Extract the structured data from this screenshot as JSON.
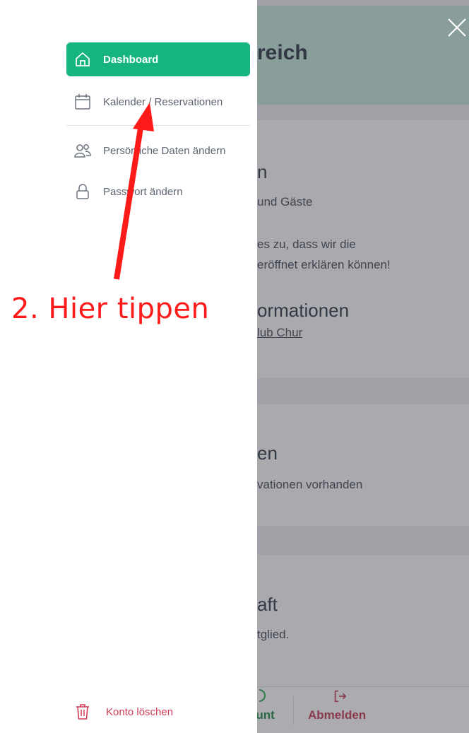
{
  "background": {
    "title_fragment": "reich",
    "card1": {
      "heading_fragment": "n",
      "line1": "und Gäste",
      "line2": "es zu, dass wir die",
      "line3": "eröffnet erklären können!",
      "heading2_fragment": "ormationen",
      "link_fragment": "lub Chur"
    },
    "card2": {
      "heading_fragment": "en",
      "line1": "vationen vorhanden"
    },
    "card3": {
      "heading_fragment": "aft",
      "line1": "tglied."
    },
    "bottom_bar": {
      "account_label": "ount",
      "logout_label": "Abmelden"
    }
  },
  "drawer": {
    "items": [
      {
        "label": "Dashboard",
        "icon": "home-icon",
        "active": true
      },
      {
        "label": "Kalender / Reservationen",
        "icon": "calendar-icon",
        "active": false
      },
      {
        "label": "Persönliche Daten ändern",
        "icon": "users-icon",
        "active": false
      },
      {
        "label": "Passwort ändern",
        "icon": "lock-icon",
        "active": false
      }
    ],
    "delete_label": "Konto löschen"
  },
  "annotation": {
    "text": "2. Hier tippen"
  },
  "colors": {
    "accent": "#16b47e",
    "danger": "#d23b54",
    "annotation": "#ff1a1a"
  }
}
